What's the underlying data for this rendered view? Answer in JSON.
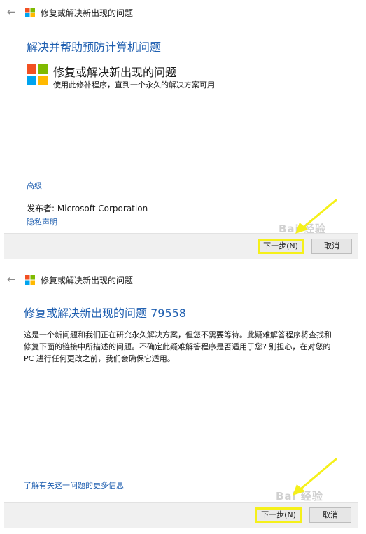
{
  "panel1": {
    "window_title": "修复或解决新出现的问题",
    "heading": "解决并帮助预防计算机问题",
    "tool_name": "修复或解决新出现的问题",
    "tool_description": "使用此修补程序，直到一个永久的解决方案可用",
    "advanced_link": "高级",
    "publisher": "发布者:  Microsoft Corporation",
    "privacy_link": "隐私声明",
    "next_button": "下一步(N)",
    "cancel_button": "取消",
    "watermark": "Bai 经验"
  },
  "panel2": {
    "window_title": "修复或解决新出现的问题",
    "heading": "修复或解决新出现的问题 79558",
    "body_text": "这是一个新问题和我们正在研究永久解决方案，但您不需要等待。此疑难解答程序将查找和修复下面的链接中所描述的问题。不确定此疑难解答程序是否适用于您? 别担心，在对您的 PC 进行任何更改之前，我们会确保它适用。",
    "more_info_link": "了解有关这一问题的更多信息",
    "next_button": "下一步(N)",
    "cancel_button": "取消",
    "watermark": "Bai 经验"
  },
  "colors": {
    "link_blue": "#1f5fb0",
    "highlight_yellow": "#f5f01a",
    "footer_gray": "#f0f0f0"
  },
  "icons": [
    "back-arrow-icon",
    "windows-logo-icon",
    "yellow-arrow-annotation"
  ]
}
